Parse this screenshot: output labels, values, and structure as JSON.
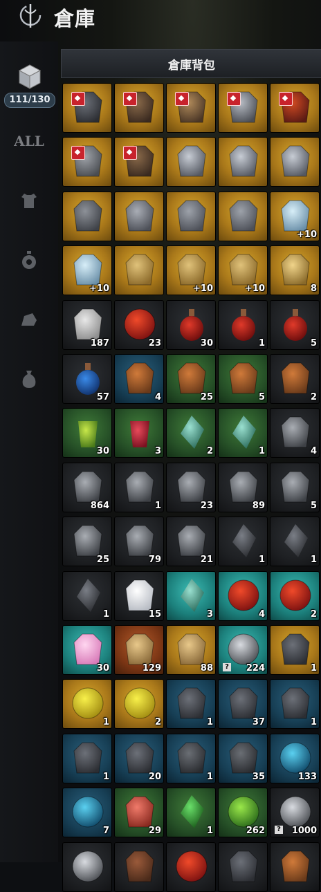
{
  "header": {
    "title": "倉庫"
  },
  "tab": {
    "label": "倉庫背包"
  },
  "sidebar": {
    "capacity": "111/130",
    "categories": [
      {
        "name": "all",
        "label": "ALL"
      },
      {
        "name": "armor-category-icon"
      },
      {
        "name": "accessory-category-icon"
      },
      {
        "name": "material-category-icon"
      },
      {
        "name": "pouch-category-icon"
      }
    ]
  },
  "colors": {
    "legendary": "#c8951f",
    "epic": "#26292d",
    "rare": "#326b2e",
    "heroic": "#23a29b",
    "unique": "#1c4a63",
    "mythic": "#96461d"
  },
  "inventory": [
    {
      "icon": "dark-armor-icon",
      "quality": "legend",
      "locked": true,
      "count": ""
    },
    {
      "icon": "crossbow-icon",
      "quality": "legend",
      "locked": true,
      "count": ""
    },
    {
      "icon": "bow-icon",
      "quality": "legend",
      "locked": true,
      "count": ""
    },
    {
      "icon": "amulet-icon",
      "quality": "legend",
      "locked": true,
      "count": ""
    },
    {
      "icon": "red-armor-icon",
      "quality": "legend",
      "locked": true,
      "count": ""
    },
    {
      "icon": "armor-icon",
      "quality": "legend",
      "locked": true,
      "count": ""
    },
    {
      "icon": "crossbow-icon",
      "quality": "legend",
      "locked": true,
      "count": ""
    },
    {
      "icon": "helmet-icon",
      "quality": "legend",
      "locked": false,
      "count": ""
    },
    {
      "icon": "helmet-icon",
      "quality": "legend",
      "locked": false,
      "count": ""
    },
    {
      "icon": "helmet-icon",
      "quality": "legend",
      "locked": false,
      "count": ""
    },
    {
      "icon": "shoulder-icon",
      "quality": "legend",
      "locked": false,
      "count": ""
    },
    {
      "icon": "pants-icon",
      "quality": "legend",
      "locked": false,
      "count": ""
    },
    {
      "icon": "boots-icon",
      "quality": "legend",
      "locked": false,
      "count": ""
    },
    {
      "icon": "boots-icon",
      "quality": "legend",
      "locked": false,
      "count": ""
    },
    {
      "icon": "earring-icon",
      "quality": "legend",
      "locked": false,
      "count": "+10"
    },
    {
      "icon": "earring-icon",
      "quality": "legend",
      "locked": false,
      "count": "+10"
    },
    {
      "icon": "ring-icon",
      "quality": "legend",
      "locked": false,
      "count": ""
    },
    {
      "icon": "ring-icon",
      "quality": "legend",
      "locked": false,
      "count": "+10"
    },
    {
      "icon": "ring-icon",
      "quality": "legend",
      "locked": false,
      "count": "+10"
    },
    {
      "icon": "card-icon",
      "quality": "legend",
      "locked": false,
      "count": "8"
    },
    {
      "icon": "scroll-icon",
      "quality": "epic",
      "locked": false,
      "count": "187"
    },
    {
      "icon": "red-orb-icon",
      "quality": "epic",
      "locked": false,
      "count": "23"
    },
    {
      "icon": "red-potion-icon",
      "quality": "epic",
      "locked": false,
      "count": "30"
    },
    {
      "icon": "red-potion-icon",
      "quality": "epic",
      "locked": false,
      "count": "1"
    },
    {
      "icon": "red-potion-icon",
      "quality": "epic",
      "locked": false,
      "count": "5"
    },
    {
      "icon": "blue-potion-icon",
      "quality": "epic",
      "locked": false,
      "count": "57"
    },
    {
      "icon": "food-plate-icon",
      "quality": "blue",
      "locked": false,
      "count": "4"
    },
    {
      "icon": "food-plate-icon",
      "quality": "rare",
      "locked": false,
      "count": "25"
    },
    {
      "icon": "food-plate-icon",
      "quality": "rare",
      "locked": false,
      "count": "5"
    },
    {
      "icon": "food-plate-icon",
      "quality": "epic",
      "locked": false,
      "count": "2"
    },
    {
      "icon": "green-drink-icon",
      "quality": "rare",
      "locked": false,
      "count": "30"
    },
    {
      "icon": "red-drink-icon",
      "quality": "rare",
      "locked": false,
      "count": "3"
    },
    {
      "icon": "crystal-icon",
      "quality": "rare",
      "locked": false,
      "count": "2"
    },
    {
      "icon": "crystal-icon",
      "quality": "rare",
      "locked": false,
      "count": "1"
    },
    {
      "icon": "stone-icon",
      "quality": "epic",
      "locked": false,
      "count": "4"
    },
    {
      "icon": "stone-icon",
      "quality": "epic",
      "locked": false,
      "count": "864"
    },
    {
      "icon": "stone-icon",
      "quality": "epic",
      "locked": false,
      "count": "1"
    },
    {
      "icon": "stone-icon",
      "quality": "epic",
      "locked": false,
      "count": "23"
    },
    {
      "icon": "stone-icon",
      "quality": "epic",
      "locked": false,
      "count": "89"
    },
    {
      "icon": "stone-icon",
      "quality": "epic",
      "locked": false,
      "count": "5"
    },
    {
      "icon": "stone-icon",
      "quality": "epic",
      "locked": false,
      "count": "25"
    },
    {
      "icon": "stone-icon",
      "quality": "epic",
      "locked": false,
      "count": "79"
    },
    {
      "icon": "stone-icon",
      "quality": "epic",
      "locked": false,
      "count": "21"
    },
    {
      "icon": "shard-icon",
      "quality": "epic",
      "locked": false,
      "count": "1"
    },
    {
      "icon": "shard-icon",
      "quality": "epic",
      "locked": false,
      "count": "1"
    },
    {
      "icon": "shard-icon",
      "quality": "epic",
      "locked": false,
      "count": "1"
    },
    {
      "icon": "diamond-icon",
      "quality": "epic",
      "locked": false,
      "count": "15"
    },
    {
      "icon": "crystal-icon",
      "quality": "cyan",
      "locked": false,
      "count": "3"
    },
    {
      "icon": "red-orb-icon",
      "quality": "cyan",
      "locked": false,
      "count": "4"
    },
    {
      "icon": "red-orb-icon",
      "quality": "cyan",
      "locked": false,
      "count": "2"
    },
    {
      "icon": "paw-icon",
      "quality": "cyan",
      "locked": false,
      "count": "30"
    },
    {
      "icon": "fist-icon",
      "quality": "orange",
      "locked": false,
      "count": "129"
    },
    {
      "icon": "fist-icon",
      "quality": "legend",
      "locked": false,
      "count": "88"
    },
    {
      "icon": "gray-orb-icon",
      "quality": "cyan",
      "locked": false,
      "count": "224",
      "unknown": "?"
    },
    {
      "icon": "dark-armor-icon",
      "quality": "legend",
      "locked": false,
      "count": "1"
    },
    {
      "icon": "yellow-orb-icon",
      "quality": "legend",
      "locked": false,
      "count": "1"
    },
    {
      "icon": "yellow-orb-icon",
      "quality": "legend",
      "locked": false,
      "count": "2"
    },
    {
      "icon": "dark-armor-icon",
      "quality": "blue",
      "locked": false,
      "count": "1"
    },
    {
      "icon": "dark-armor-icon",
      "quality": "blue",
      "locked": false,
      "count": "37"
    },
    {
      "icon": "dark-armor-icon",
      "quality": "blue",
      "locked": false,
      "count": "1"
    },
    {
      "icon": "dark-armor-icon",
      "quality": "blue",
      "locked": false,
      "count": "1"
    },
    {
      "icon": "dark-armor-icon",
      "quality": "blue",
      "locked": false,
      "count": "20"
    },
    {
      "icon": "horn-icon",
      "quality": "blue",
      "locked": false,
      "count": "1"
    },
    {
      "icon": "horn-icon",
      "quality": "blue",
      "locked": false,
      "count": "35"
    },
    {
      "icon": "blue-orb-icon",
      "quality": "blue",
      "locked": false,
      "count": "133"
    },
    {
      "icon": "blue-orb-icon",
      "quality": "blue",
      "locked": false,
      "count": "7"
    },
    {
      "icon": "meat-icon",
      "quality": "rare",
      "locked": false,
      "count": "29"
    },
    {
      "icon": "green-shard-icon",
      "quality": "rare",
      "locked": false,
      "count": "1"
    },
    {
      "icon": "green-orb-icon",
      "quality": "rare",
      "locked": false,
      "count": "262"
    },
    {
      "icon": "gray-orb-icon",
      "quality": "epic",
      "locked": false,
      "count": "1000",
      "unknown": "?"
    },
    {
      "icon": "gray-orb-icon",
      "quality": "epic",
      "locked": false,
      "count": ""
    },
    {
      "icon": "chest-icon",
      "quality": "epic",
      "locked": false,
      "count": ""
    },
    {
      "icon": "red-orb-icon",
      "quality": "epic",
      "locked": false,
      "count": ""
    },
    {
      "icon": "dark-armor-icon",
      "quality": "epic",
      "locked": false,
      "count": ""
    },
    {
      "icon": "food-plate-icon",
      "quality": "epic",
      "locked": false,
      "count": ""
    }
  ]
}
